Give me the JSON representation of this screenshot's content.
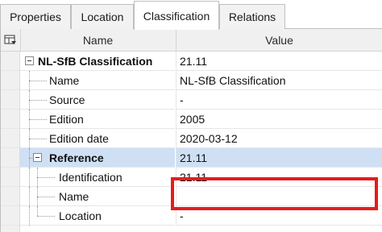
{
  "tabs": [
    {
      "label": "Properties"
    },
    {
      "label": "Location"
    },
    {
      "label": "Classification"
    },
    {
      "label": "Relations"
    }
  ],
  "grid": {
    "header": {
      "name": "Name",
      "value": "Value",
      "icon": "column-chooser-icon"
    },
    "rows": [
      {
        "name": "NL-SfB Classification",
        "value": "21.11"
      },
      {
        "name": "Name",
        "value": "NL-SfB Classification"
      },
      {
        "name": "Source",
        "value": "-"
      },
      {
        "name": "Edition",
        "value": "2005"
      },
      {
        "name": "Edition date",
        "value": "2020-03-12"
      },
      {
        "name": "Reference",
        "value": "21.11"
      },
      {
        "name": "Identification",
        "value": "21.11"
      },
      {
        "name": "Name",
        "value": ""
      },
      {
        "name": "Location",
        "value": "-"
      }
    ]
  },
  "highlight_color": "#e81b1b",
  "selection_color": "#cfe0f5"
}
